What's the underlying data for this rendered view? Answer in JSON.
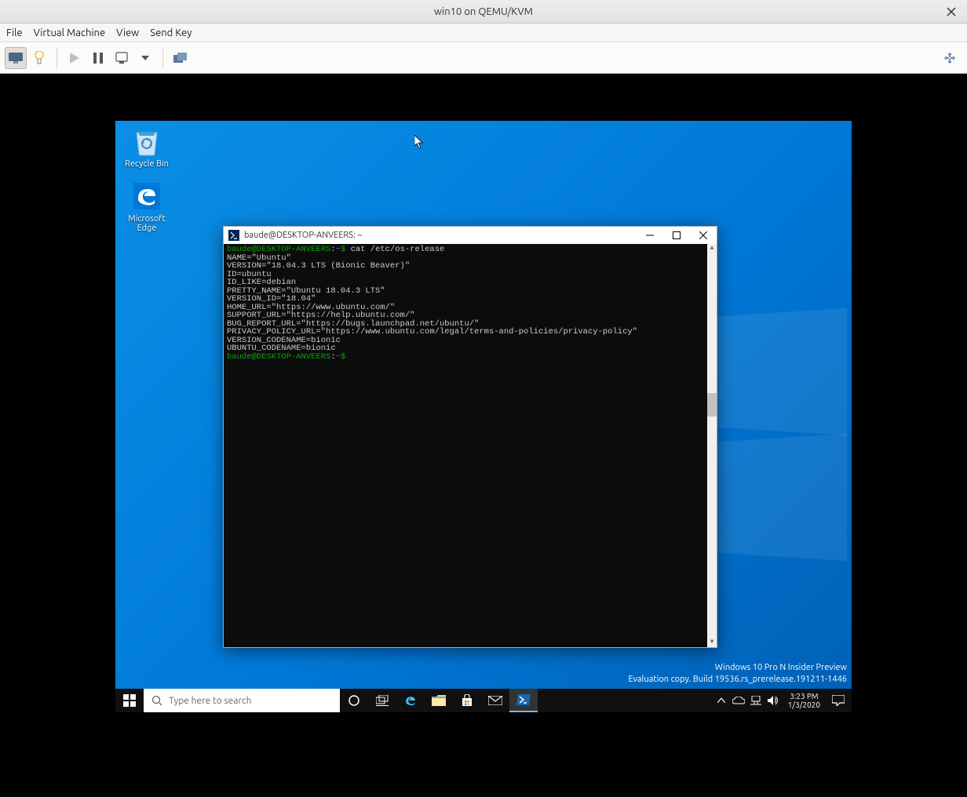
{
  "vm": {
    "title": "win10 on QEMU/KVM",
    "menu": {
      "file": "File",
      "virtual_machine": "Virtual Machine",
      "view": "View",
      "send_key": "Send Key"
    }
  },
  "desktop": {
    "icons": {
      "recycle_bin": "Recycle Bin",
      "edge": "Microsoft\nEdge"
    },
    "watermark": {
      "line1": "Windows 10 Pro N Insider Preview",
      "line2": "Evaluation copy. Build 19536.rs_prerelease.191211-1446"
    }
  },
  "taskbar": {
    "search_placeholder": "Type here to search",
    "time": "3:23 PM",
    "date": "1/3/2020"
  },
  "terminal": {
    "title": "baude@DESKTOP-ANVEERS: ~",
    "prompt_user": "baude@DESKTOP-ANVEERS",
    "prompt_sep": ":",
    "prompt_path": "~",
    "prompt_dollar": "$",
    "cmd": "cat /etc/os-release",
    "out": {
      "l1": "NAME=\"Ubuntu\"",
      "l2": "VERSION=\"18.04.3 LTS (Bionic Beaver)\"",
      "l3": "ID=ubuntu",
      "l4": "ID_LIKE=debian",
      "l5": "PRETTY_NAME=\"Ubuntu 18.04.3 LTS\"",
      "l6": "VERSION_ID=\"18.04\"",
      "l7": "HOME_URL=\"https://www.ubuntu.com/\"",
      "l8": "SUPPORT_URL=\"https://help.ubuntu.com/\"",
      "l9": "BUG_REPORT_URL=\"https://bugs.launchpad.net/ubuntu/\"",
      "l10": "PRIVACY_POLICY_URL=\"https://www.ubuntu.com/legal/terms-and-policies/privacy-policy\"",
      "l11": "VERSION_CODENAME=bionic",
      "l12": "UBUNTU_CODENAME=bionic"
    }
  }
}
